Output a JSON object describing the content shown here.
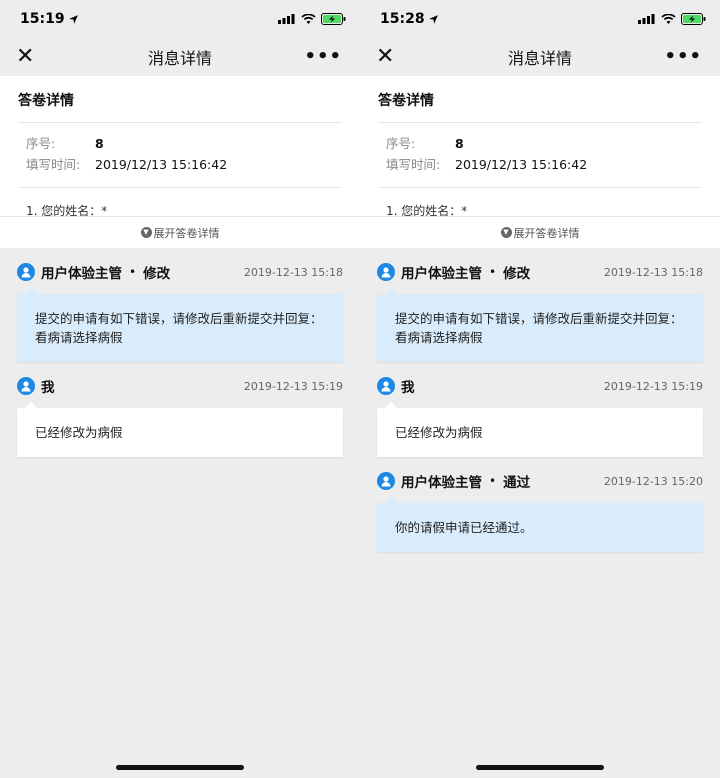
{
  "screens": [
    {
      "status": {
        "time": "15:19"
      },
      "nav": {
        "title": "消息详情",
        "close": "✕",
        "more": "•••"
      },
      "survey": {
        "title": "答卷详情",
        "serial_label": "序号:",
        "serial_value": "8",
        "time_label": "填写时间:",
        "time_value": "2019/12/13 15:16:42",
        "question": "1. 您的姓名：*",
        "expand_label": "展开答卷详情"
      },
      "messages": [
        {
          "sender": "用户体验主管",
          "action": "修改",
          "time": "2019-12-13 15:18",
          "line1": "提交的申请有如下错误，请修改后重新提交并回复：",
          "line2": "看病请选择病假"
        },
        {
          "sender": "我",
          "time": "2019-12-13 15:19",
          "text": "已经修改为病假"
        }
      ]
    },
    {
      "status": {
        "time": "15:28"
      },
      "nav": {
        "title": "消息详情",
        "close": "✕",
        "more": "•••"
      },
      "survey": {
        "title": "答卷详情",
        "serial_label": "序号:",
        "serial_value": "8",
        "time_label": "填写时间:",
        "time_value": "2019/12/13 15:16:42",
        "question": "1. 您的姓名：*",
        "expand_label": "展开答卷详情"
      },
      "messages": [
        {
          "sender": "用户体验主管",
          "action": "修改",
          "time": "2019-12-13 15:18",
          "line1": "提交的申请有如下错误，请修改后重新提交并回复：",
          "line2": "看病请选择病假"
        },
        {
          "sender": "我",
          "time": "2019-12-13 15:19",
          "text": "已经修改为病假"
        },
        {
          "sender": "用户体验主管",
          "action": "通过",
          "time": "2019-12-13 15:20",
          "text": "你的请假申请已经通过。"
        }
      ]
    }
  ],
  "colors": {
    "accent": "#1e88e5",
    "bubble_blue": "#d9ecfb",
    "background": "#ededed",
    "battery": "#4cd964"
  }
}
